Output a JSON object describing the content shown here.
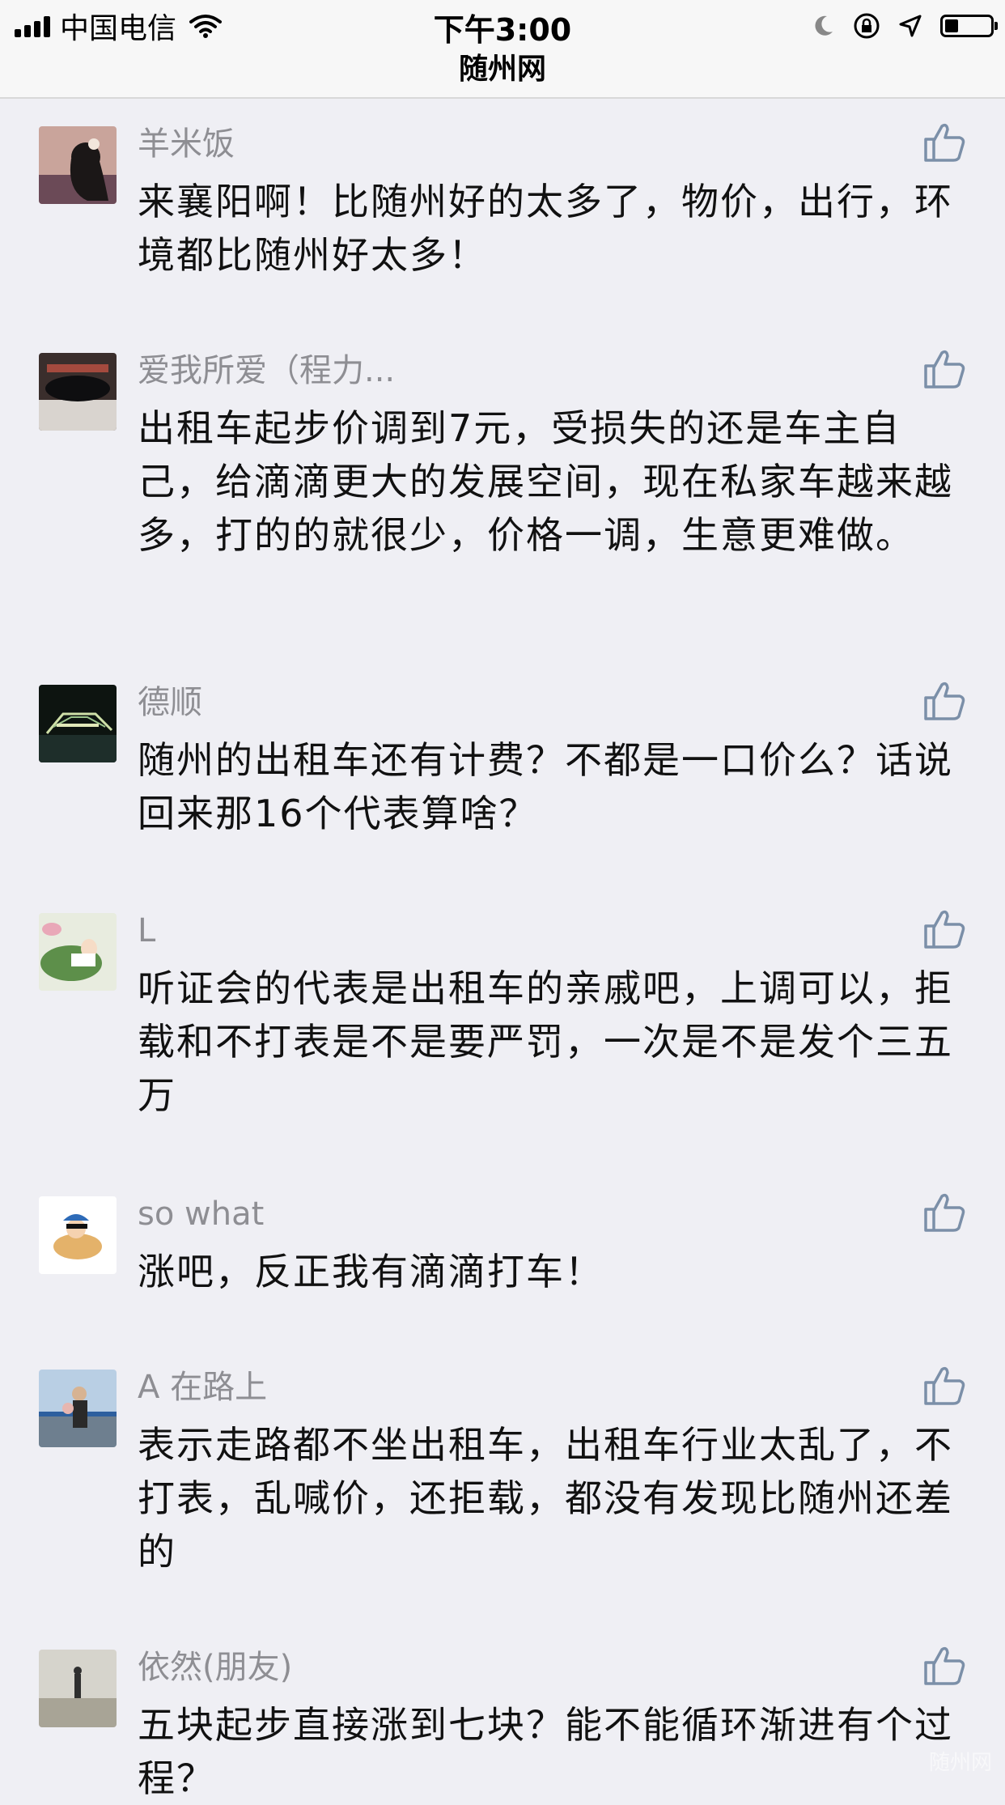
{
  "status_bar": {
    "carrier": "中国电信",
    "time": "下午3:00",
    "title": "随州网"
  },
  "comments": [
    {
      "user": "羊米饭",
      "text": "来襄阳啊！比随州好的太多了，物价，出行，环境都比随州好太多！"
    },
    {
      "user": "爱我所爱（程力...",
      "text": "出租车起步价调到7元，受损失的还是车主自己，给滴滴更大的发展空间，现在私家车越来越多，打的的就很少，价格一调，生意更难做。"
    },
    {
      "user": "德顺",
      "text": "随州的出租车还有计费？不都是一口价么？话说回来那16个代表算啥？"
    },
    {
      "user": "L",
      "text": "听证会的代表是出租车的亲戚吧，上调可以，拒载和不打表是不是要严罚，一次是不是发个三五万"
    },
    {
      "user": "so what",
      "text": "涨吧，反正我有滴滴打车！"
    },
    {
      "user": "A 在路上",
      "text": "表示走路都不坐出租车，出租车行业太乱了，不打表，乱喊价，还拒载，都没有发现比随州还差的"
    },
    {
      "user": "依然(朋友)",
      "text": "五块起步直接涨到七块？能不能循环渐进有个过程？"
    }
  ],
  "watermark": "随州网",
  "icons": {
    "like": "thumbs-up-icon",
    "wifi": "wifi-icon",
    "moon": "moon-icon",
    "lock_rotation": "rotation-lock-icon",
    "location": "location-arrow-icon",
    "battery": "battery-icon"
  }
}
